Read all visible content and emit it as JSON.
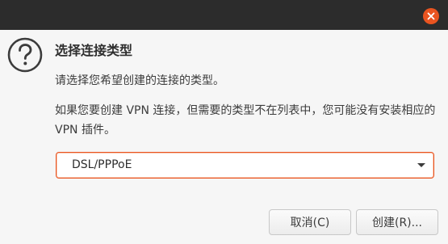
{
  "window": {
    "close_icon": "close-icon",
    "accent_color": "#e95420"
  },
  "dialog": {
    "icon": "question-icon",
    "title": "选择连接类型",
    "subtitle": "请选择您希望创建的连接的类型。",
    "message": "如果您要创建 VPN 连接，但需要的类型不在列表中，您可能没有安装相应的 VPN 插件。",
    "connection_type": {
      "selected": "DSL/PPPoE"
    },
    "buttons": {
      "cancel": "取消(C)",
      "create": "创建(R)..."
    }
  }
}
